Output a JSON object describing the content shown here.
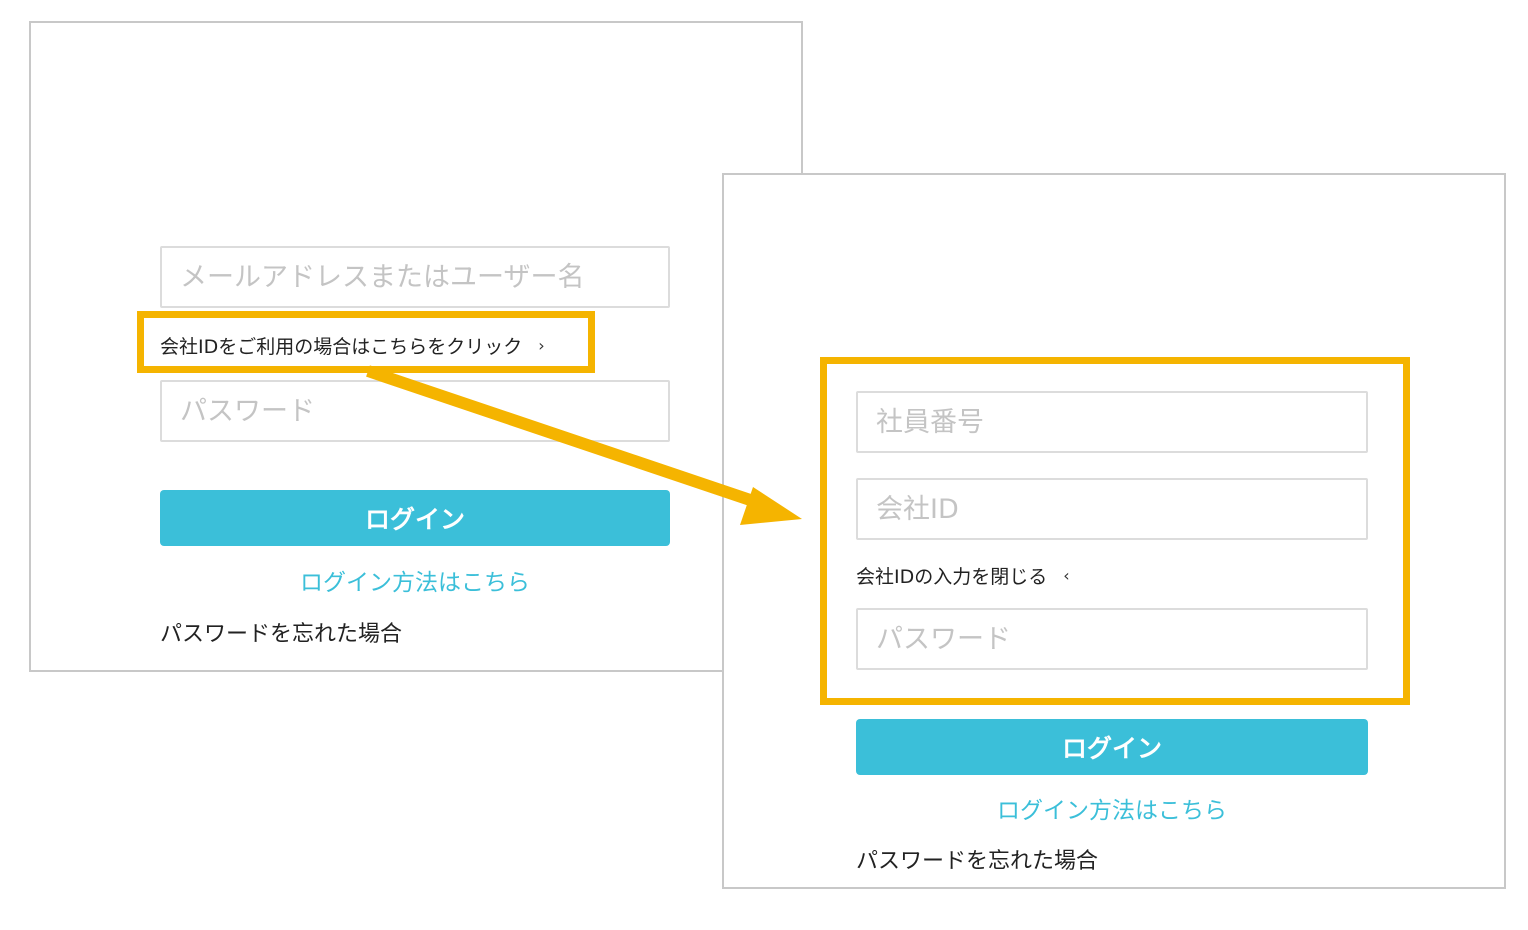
{
  "left_panel": {
    "username_placeholder": "メールアドレスまたはユーザー名",
    "company_id_toggle": "会社IDをご利用の場合はこちらをクリック",
    "company_id_toggle_icon": "chevron-right-icon",
    "password_placeholder": "パスワード",
    "login_button": "ログイン",
    "login_method_link": "ログイン方法はこちら",
    "forgot_password_link": "パスワードを忘れた場合"
  },
  "right_panel": {
    "employee_number_placeholder": "社員番号",
    "company_id_placeholder": "会社ID",
    "close_company_id_link": "会社IDの入力を閉じる",
    "close_company_id_icon": "chevron-left-icon",
    "password_placeholder": "パスワード",
    "login_button": "ログイン",
    "login_method_link": "ログイン方法はこちら",
    "forgot_password_link": "パスワードを忘れた場合"
  },
  "colors": {
    "accent": "#3bbfd9",
    "highlight": "#f5b400",
    "panel_border": "#c8c8c8"
  }
}
